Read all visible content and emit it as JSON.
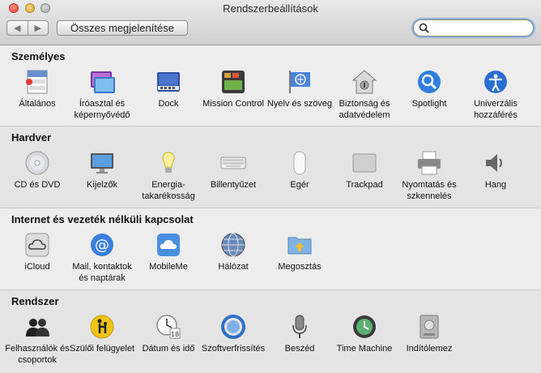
{
  "window": {
    "title": "Rendszerbeállítások"
  },
  "toolbar": {
    "back_label": "◀",
    "forward_label": "▶",
    "show_all_label": "Összes megjelenítése"
  },
  "search": {
    "value": "",
    "placeholder": ""
  },
  "sections": [
    {
      "title": "Személyes",
      "items": [
        {
          "label": "Általános",
          "icon": "general-file-icon"
        },
        {
          "label": "Íróasztal és képernyővédő",
          "icon": "desktop-screensaver-icon"
        },
        {
          "label": "Dock",
          "icon": "dock-icon"
        },
        {
          "label": "Mission Control",
          "icon": "mission-control-icon"
        },
        {
          "label": "Nyelv és szöveg",
          "icon": "language-flag-icon"
        },
        {
          "label": "Biztonság és adatvédelem",
          "icon": "security-house-icon"
        },
        {
          "label": "Spotlight",
          "icon": "spotlight-magnifier-icon"
        },
        {
          "label": "Univerzális hozzáférés",
          "icon": "accessibility-icon"
        }
      ]
    },
    {
      "title": "Hardver",
      "items": [
        {
          "label": "CD és DVD",
          "icon": "cd-dvd-icon"
        },
        {
          "label": "Kijelzők",
          "icon": "displays-icon"
        },
        {
          "label": "Energia-takarékosság",
          "icon": "energy-bulb-icon"
        },
        {
          "label": "Billentyűzet",
          "icon": "keyboard-icon"
        },
        {
          "label": "Egér",
          "icon": "mouse-icon"
        },
        {
          "label": "Trackpad",
          "icon": "trackpad-icon"
        },
        {
          "label": "Nyomtatás és szkennelés",
          "icon": "printer-icon"
        },
        {
          "label": "Hang",
          "icon": "speaker-icon"
        }
      ]
    },
    {
      "title": "Internet és vezeték nélküli kapcsolat",
      "items": [
        {
          "label": "iCloud",
          "icon": "icloud-icon"
        },
        {
          "label": "Mail, kontaktok és naptárak",
          "icon": "mail-at-icon"
        },
        {
          "label": "MobileMe",
          "icon": "mobileme-cloud-icon"
        },
        {
          "label": "Hálózat",
          "icon": "network-globe-icon"
        },
        {
          "label": "Megosztás",
          "icon": "sharing-folder-icon"
        }
      ]
    },
    {
      "title": "Rendszer",
      "items": [
        {
          "label": "Felhasználók és csoportok",
          "icon": "users-groups-icon"
        },
        {
          "label": "Szülői felügyelet",
          "icon": "parental-controls-icon"
        },
        {
          "label": "Dátum és idő",
          "icon": "date-time-clock-icon"
        },
        {
          "label": "Szoftverfrissítés",
          "icon": "software-update-icon"
        },
        {
          "label": "Beszéd",
          "icon": "speech-microphone-icon"
        },
        {
          "label": "Time Machine",
          "icon": "time-machine-icon"
        },
        {
          "label": "Indítólemez",
          "icon": "startup-disk-icon"
        }
      ]
    }
  ]
}
